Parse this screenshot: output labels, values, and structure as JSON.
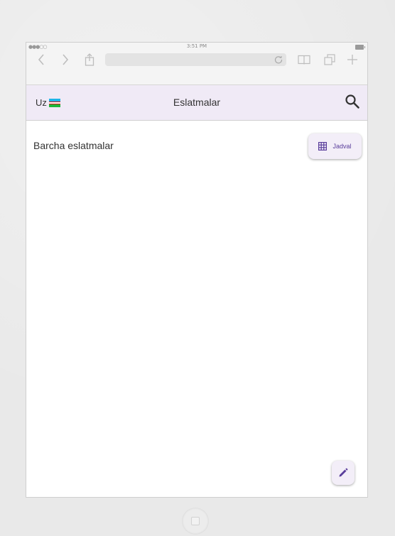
{
  "status_bar": {
    "time": "3:51 PM"
  },
  "browser": {
    "toolbar_icons": [
      "back-icon",
      "forward-icon",
      "share-icon",
      "reload-icon",
      "bookmarks-icon",
      "tabs-icon",
      "new-tab-icon"
    ]
  },
  "header": {
    "language": "Uz",
    "title": "Eslatmalar",
    "search_icon": "search-icon",
    "colors": {
      "background": "#f0eaf6"
    }
  },
  "main": {
    "section_title": "Barcha eslatmalar",
    "view_toggle_label": "Jadval",
    "view_toggle_icon": "grid-icon",
    "fab_icon": "pencil-icon",
    "accent_color": "#5a3e9b"
  }
}
